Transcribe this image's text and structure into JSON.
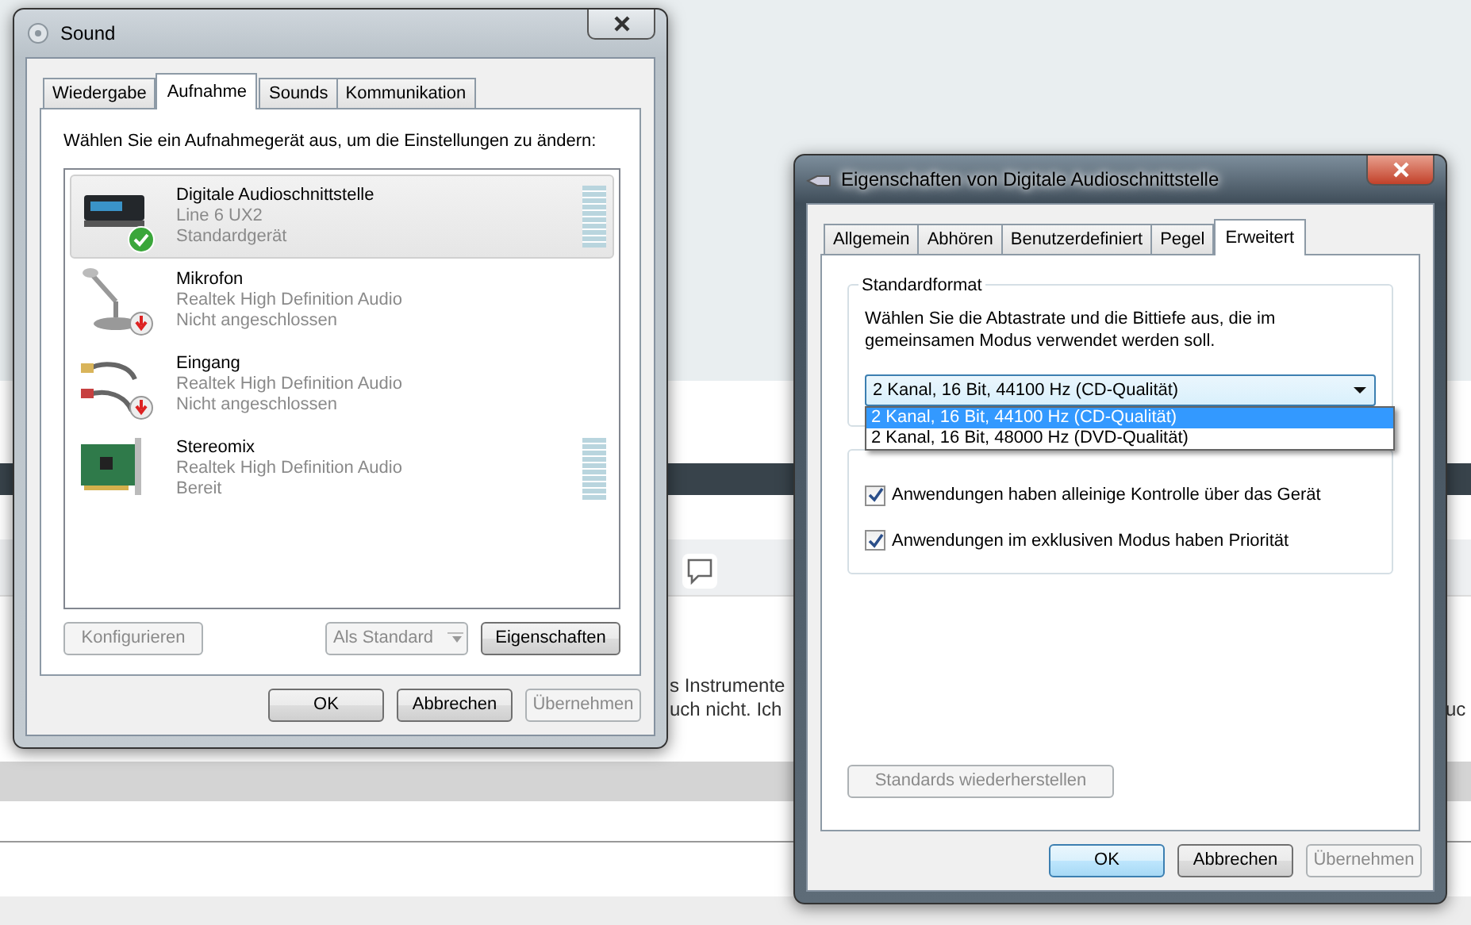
{
  "background_page": {
    "texts": [
      "s Instrumente",
      "uch nicht. Ich",
      "uc"
    ]
  },
  "sound_window": {
    "title": "Sound",
    "active": false,
    "tabs": [
      {
        "label": "Wiedergabe",
        "selected": false
      },
      {
        "label": "Aufnahme",
        "selected": true
      },
      {
        "label": "Sounds",
        "selected": false
      },
      {
        "label": "Kommunikation",
        "selected": false
      }
    ],
    "instruction": "Wählen Sie ein Aufnahmegerät aus, um die Einstellungen zu ändern:",
    "devices": [
      {
        "kind": "interface",
        "name": "Digitale Audioschnittstelle",
        "driver": "Line 6 UX2",
        "status_text": "Standardgerät",
        "default": true,
        "connected": true,
        "selected": true,
        "meter": {
          "level": 0
        }
      },
      {
        "kind": "microphone",
        "name": "Mikrofon",
        "driver": "Realtek High Definition Audio",
        "status_text": "Nicht angeschlossen",
        "default": false,
        "connected": false,
        "selected": false
      },
      {
        "kind": "jack",
        "name": "Eingang",
        "driver": "Realtek High Definition Audio",
        "status_text": "Nicht angeschlossen",
        "default": false,
        "connected": false,
        "selected": false
      },
      {
        "kind": "card",
        "name": "Stereomix",
        "driver": "Realtek High Definition Audio",
        "status_text": "Bereit",
        "default": false,
        "connected": true,
        "selected": false,
        "meter": {
          "level": 0
        }
      }
    ],
    "list_buttons": [
      {
        "label": "Konfigurieren",
        "disabled": true
      },
      {
        "label": "Als Standard",
        "disabled": true,
        "split": true
      },
      {
        "label": "Eigenschaften",
        "disabled": false
      }
    ],
    "buttons": [
      {
        "label": "OK",
        "disabled": false,
        "default": false
      },
      {
        "label": "Abbrechen",
        "disabled": false,
        "default": false
      },
      {
        "label": "Übernehmen",
        "disabled": true,
        "default": false
      }
    ]
  },
  "properties_window": {
    "title": "Eigenschaften von Digitale Audioschnittstelle",
    "active": true,
    "tabs": [
      {
        "label": "Allgemein",
        "selected": false
      },
      {
        "label": "Abhören",
        "selected": false
      },
      {
        "label": "Benutzerdefiniert",
        "selected": false
      },
      {
        "label": "Pegel",
        "selected": false
      },
      {
        "label": "Erweitert",
        "selected": true
      }
    ],
    "format_group": {
      "title": "Standardformat",
      "description": "Wählen Sie die Abtastrate und die Bittiefe aus, die im gemeinsamen Modus verwendet werden soll.",
      "combo_value": "2 Kanal, 16 Bit, 44100 Hz (CD-Qualität)",
      "options": [
        {
          "label": "2 Kanal, 16 Bit, 44100 Hz (CD-Qualität)",
          "selected": true
        },
        {
          "label": "2 Kanal, 16 Bit, 48000 Hz (DVD-Qualität)",
          "selected": false
        }
      ]
    },
    "exclusive_group": {
      "checkboxes": [
        {
          "label": "Anwendungen haben alleinige Kontrolle über das Gerät",
          "checked": true
        },
        {
          "label": "Anwendungen im exklusiven Modus haben Priorität",
          "checked": true
        }
      ]
    },
    "restore_button": {
      "label": "Standards wiederherstellen",
      "disabled": true
    },
    "buttons": [
      {
        "label": "OK",
        "disabled": false,
        "default": true
      },
      {
        "label": "Abbrechen",
        "disabled": false,
        "default": false
      },
      {
        "label": "Übernehmen",
        "disabled": true,
        "default": false
      }
    ]
  }
}
